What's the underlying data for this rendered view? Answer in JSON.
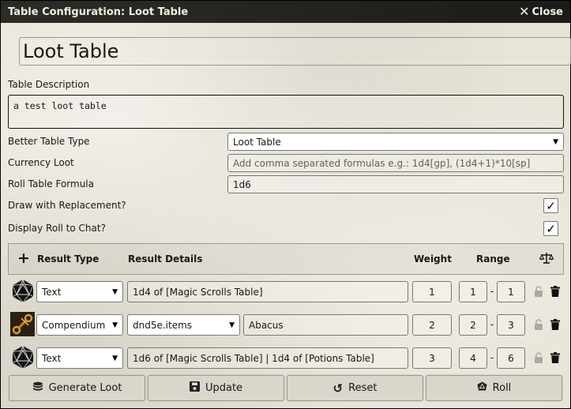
{
  "window": {
    "title": "Table Configuration: Loot Table",
    "close_label": "Close"
  },
  "table_name": "Loot Table",
  "description": {
    "label": "Table Description",
    "value": "a test loot table"
  },
  "better_table_type": {
    "label": "Better Table Type",
    "value": "Loot Table"
  },
  "currency_loot": {
    "label": "Currency Loot",
    "placeholder": "Add comma separated formulas e.g.: 1d4[gp], (1d4+1)*10[sp]"
  },
  "roll_formula": {
    "label": "Roll Table Formula",
    "value": "1d6"
  },
  "draw_with_replacement": {
    "label": "Draw with Replacement?",
    "checked": true
  },
  "display_roll": {
    "label": "Display Roll to Chat?",
    "checked": true
  },
  "results_header": {
    "add_icon": "plus-icon",
    "type": "Result Type",
    "details": "Result Details",
    "weight": "Weight",
    "range": "Range",
    "normalize_icon": "balance-scale-icon"
  },
  "results": [
    {
      "icon": "d20-icon",
      "type": "Text",
      "details": "1d4 of [Magic Scrolls Table]",
      "weight": "1",
      "range_low": "1",
      "range_high": "1"
    },
    {
      "icon": "compendium-item-icon",
      "type": "Compendium",
      "pack": "dnd5e.items",
      "details": "Abacus",
      "weight": "2",
      "range_low": "2",
      "range_high": "3"
    },
    {
      "icon": "d20-icon",
      "type": "Text",
      "details": "1d6 of [Magic Scrolls Table] | 1d4 of [Potions Table]",
      "weight": "3",
      "range_low": "4",
      "range_high": "6"
    }
  ],
  "buttons": {
    "generate": "Generate Loot",
    "update": "Update",
    "reset": "Reset",
    "roll": "Roll"
  },
  "colors": {
    "header_bg": "#1e1d1a",
    "header_text": "#f0f0e0",
    "parchment": "#e6e2d6"
  }
}
